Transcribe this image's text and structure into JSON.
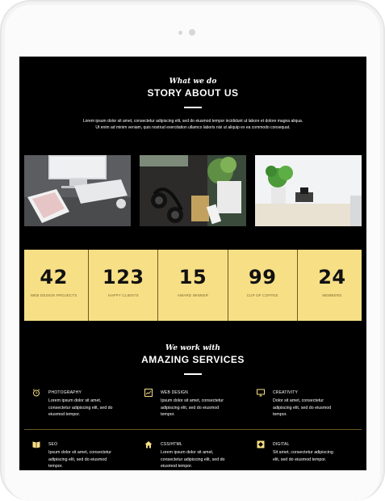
{
  "story": {
    "kicker": "What we do",
    "heading": "STORY ABOUT US",
    "intro_line1": "Lorem ipsum dolor sit amet, consectetur adipiscing elit, sed do eiusmod tempor incididunt ut labore et dolore magna aliqua.",
    "intro_line2": "Ut enim ad minim veniam, quis nostrud exercitation ullamco laboris nisi ut aliquip ex ea commodo consequat."
  },
  "stats": [
    {
      "value": "42",
      "label": "WEB DESIGN PROJECTS"
    },
    {
      "value": "123",
      "label": "HAPPY CLIENTS"
    },
    {
      "value": "15",
      "label": "AWARD WINNER"
    },
    {
      "value": "99",
      "label": "CUP OF COFFEE"
    },
    {
      "value": "24",
      "label": "MEMBERS"
    }
  ],
  "services_header": {
    "kicker": "We work with",
    "heading": "AMAZING SERVICES"
  },
  "services": [
    {
      "icon": "alarm-clock-icon",
      "title": "PHOTOGRAPHY",
      "text1": "Lorem ipsum dolor sit amet,",
      "text2": "consectetur adipiscing elit, sed do",
      "text3": "eiusmod tempor."
    },
    {
      "icon": "chart-icon",
      "title": "WEB DESIGN",
      "text1": "Ipsum dolor sit amet, consectetur",
      "text2": "adipiscing elit, sed do eiusmod",
      "text3": "tempor."
    },
    {
      "icon": "monitor-icon",
      "title": "CREATIVITY",
      "text1": "Dolor sit amet, consectetur",
      "text2": "adipiscing elit, sed do eiusmod",
      "text3": "tempor."
    },
    {
      "icon": "book-icon",
      "title": "SEO",
      "text1": "Ipsum dolor sit amet, consectetur",
      "text2": "adipiscing elit, sed do eiusmod",
      "text3": "tempor."
    },
    {
      "icon": "home-icon",
      "title": "CSS/HTML",
      "text1": "Lorem ipsum dolor sit amet,",
      "text2": "consectetur adipiscing elit, sed do",
      "text3": "eiusmod tempor."
    },
    {
      "icon": "diamond-icon",
      "title": "DIGITAL",
      "text1": "Sit amet, consectetur adipiscing",
      "text2": "elit, sed do eiusmod tempor.",
      "text3": ""
    }
  ],
  "colors": {
    "accent_yellow": "#f7df86",
    "background": "#000000",
    "text": "#ffffff"
  }
}
